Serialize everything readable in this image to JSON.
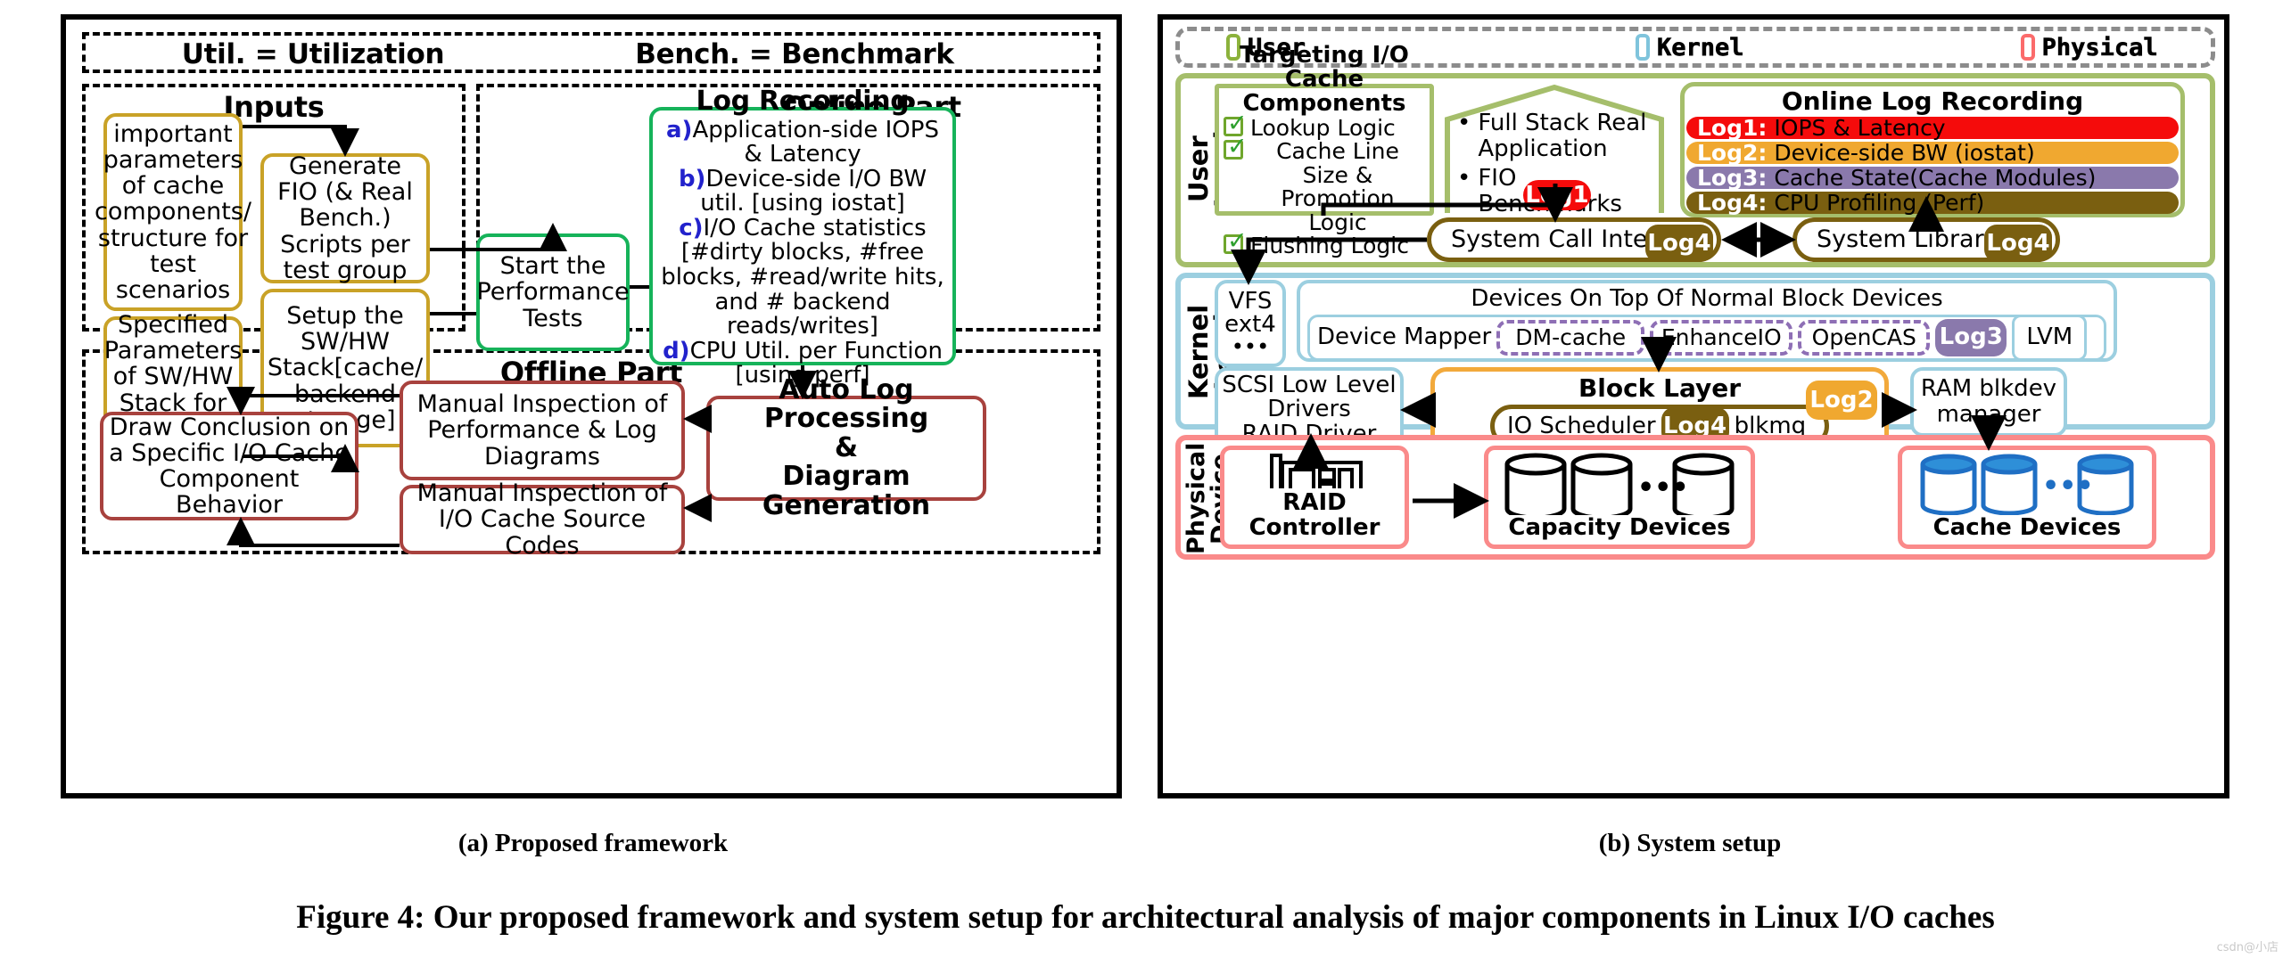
{
  "figure": {
    "caption": "Figure 4: Our proposed framework and system setup for architectural analysis of major components in Linux I/O caches",
    "sub_caption_a": "(a) Proposed framework",
    "sub_caption_b": "(b) System setup",
    "watermark": "csdn@小店"
  },
  "panel_a": {
    "abbrev_util": "Util. = Utilization",
    "abbrev_bench": "Bench. = Benchmark",
    "inputs": {
      "title": "Inputs",
      "box_params": "important parameters of cache components/ structure for test scenarios",
      "box_specified": "Specified Parameters of SW/HW Stack for test Scenarios",
      "box_generate_fio": "Generate FIO (& Real Bench.) Scripts per test group",
      "box_setup_stack": "Setup the SW/HW Stack[cache/ backend storage]"
    },
    "online": {
      "title": "Online Part",
      "start_tests": "Start the Performance Tests",
      "log_recording": {
        "title": "Log Recording",
        "items": [
          {
            "marker": "a)",
            "text": "Application-side IOPS & Latency"
          },
          {
            "marker": "b)",
            "text": "Device-side I/O BW util. [using iostat]"
          },
          {
            "marker": "c)",
            "text": "I/O Cache statistics [#dirty blocks, #free blocks, #read/write hits, and # backend reads/writes]"
          },
          {
            "marker": "d)",
            "text": "CPU Util. per Function [using perf]"
          }
        ]
      }
    },
    "offline": {
      "title": "Offline Part",
      "box_conclusion": "Draw Conclusion on a Specific I/O Cache Component Behavior",
      "box_manual_perf": "Manual Inspection of Performance & Log Diagrams",
      "box_manual_src": "Manual Inspection of I/O Cache Source Codes",
      "box_auto": "Auto Log Processing & Diagram Generation",
      "box_auto_l1": "Auto Log Processing",
      "box_auto_l2": "&",
      "box_auto_l3": "Diagram Generation"
    }
  },
  "panel_b": {
    "legend": [
      {
        "label": "User",
        "color": "#8CB23C"
      },
      {
        "label": "Kernel",
        "color": "#7FC4DC"
      },
      {
        "label": "Physical",
        "color": "#FB6B6B"
      }
    ],
    "levels": {
      "user": "User Level",
      "kernel": "Kernel Level",
      "physical": "Physical Device"
    },
    "user_level": {
      "targeting": {
        "title_l1": "Targeting I/O",
        "title_l2": "Cache Components",
        "items": [
          "Lookup Logic",
          "Cache Line Size & Promotion Logic",
          "Flushing Logic"
        ]
      },
      "workloads": {
        "items": [
          "Full Stack Real Application",
          "FIO Benchmarks"
        ],
        "log_tag": "Log1"
      },
      "online_log_recording": {
        "title": "Online Log Recording",
        "rows": [
          {
            "tag": "Log1:",
            "text": "IOPS & Latency",
            "color": "#F50B0B"
          },
          {
            "tag": "Log2:",
            "text": "Device-side BW (iostat)",
            "color": "#F0A830"
          },
          {
            "tag": "Log3:",
            "text": "Cache State(Cache Modules)",
            "color": "#8A79AC"
          },
          {
            "tag": "Log4:",
            "text": "CPU Profiling (Perf)",
            "color": "#7A5F10"
          }
        ]
      },
      "syscall": {
        "label": "System Call Interface",
        "tag": "Log4"
      },
      "syslib": {
        "label": "System Library",
        "tag": "Log4"
      }
    },
    "kernel_level": {
      "vfs": "VFS\next4\n•••",
      "vfs_l1": "VFS",
      "vfs_l2": "ext4",
      "vfs_l3": "•••",
      "devices_title": "Devices On Top Of Normal Block Devices",
      "device_mapper": "Device Mapper",
      "dm_modules": [
        "DM-cache",
        "EnhanceIO",
        "OpenCAS"
      ],
      "dm_log_tag": "Log3",
      "lvm": "LVM",
      "scsi_l1": "SCSI Low Level",
      "scsi_l2": "Drivers",
      "scsi_l3": "RAID Driver",
      "block_layer_title": "Block Layer",
      "block_layer_tag": "Log2",
      "io_scheduler": "IO Scheduler",
      "io_scheduler_tag": "Log4",
      "blkmq": "blkmq",
      "ram_l1": "RAM blkdev",
      "ram_l2": "manager"
    },
    "physical_level": {
      "raid_controller": "RAID Controller",
      "capacity_devices": "Capacity Devices",
      "cache_devices": "Cache Devices",
      "ellipsis": "•••"
    }
  }
}
